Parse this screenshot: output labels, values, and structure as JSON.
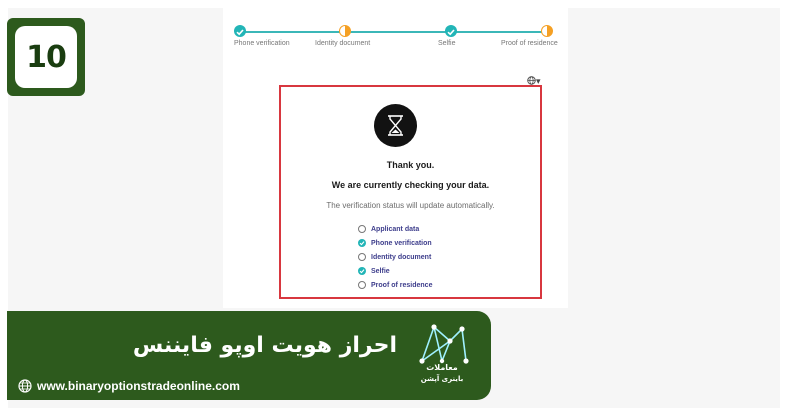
{
  "step_number": "10",
  "stepper": {
    "steps": [
      {
        "label": "Phone verification",
        "state": "done"
      },
      {
        "label": "Identity document",
        "state": "partial"
      },
      {
        "label": "Selfie",
        "state": "done"
      },
      {
        "label": "Proof of residence",
        "state": "partial"
      }
    ]
  },
  "language_selector": {
    "icon": "globe-icon",
    "caret": "▾"
  },
  "status_card": {
    "icon": "hourglass-icon",
    "title": "Thank you.",
    "subtitle": "We are currently checking your data.",
    "note": "The verification status will update automatically.",
    "checklist": [
      {
        "label": "Applicant data",
        "done": false
      },
      {
        "label": "Phone verification",
        "done": true
      },
      {
        "label": "Identity document",
        "done": false
      },
      {
        "label": "Selfie",
        "done": true
      },
      {
        "label": "Proof of residence",
        "done": false
      }
    ]
  },
  "banner": {
    "title": "احراز هویت اوپو فایننس",
    "url": "www.binaryoptionstradeonline.com",
    "logo_line1": "معاملات",
    "logo_line2": "باینری آپشن"
  },
  "colors": {
    "brand_green": "#2d5a1d",
    "highlight_red": "#d8373f",
    "teal": "#22b5b7",
    "orange": "#f5a024"
  }
}
